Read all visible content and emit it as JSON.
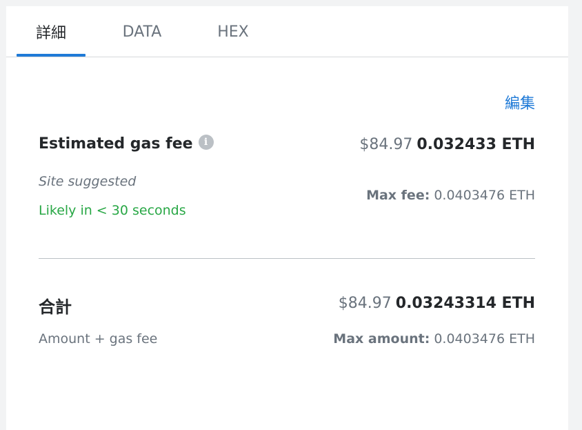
{
  "tabs": [
    {
      "label": "詳細",
      "active": true
    },
    {
      "label": "DATA",
      "active": false
    },
    {
      "label": "HEX",
      "active": false
    }
  ],
  "edit_label": "編集",
  "gas": {
    "title": "Estimated gas fee",
    "info_icon": "info-icon",
    "fiat": "$84.97",
    "crypto": "0.032433 ETH",
    "site_suggested": "Site suggested",
    "likely": "Likely in < 30 seconds",
    "max_fee_label": "Max fee:",
    "max_fee_value": "0.0403476 ETH"
  },
  "total": {
    "title": "合計",
    "fiat": "$84.97",
    "crypto": "0.03243314 ETH",
    "subtitle": "Amount + gas fee",
    "max_amount_label": "Max amount:",
    "max_amount_value": "0.0403476 ETH"
  },
  "colors": {
    "accent": "#1f7ad7",
    "success": "#28a745",
    "muted": "#6a737d",
    "text": "#24272a"
  }
}
